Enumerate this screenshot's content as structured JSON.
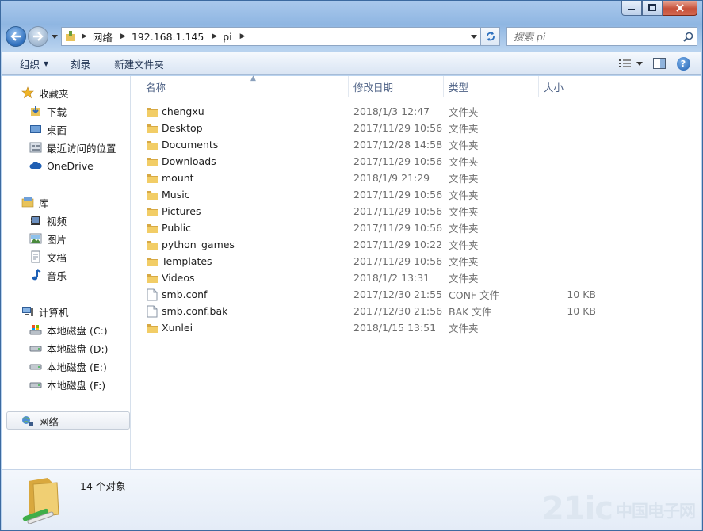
{
  "window": {
    "caption_buttons": [
      "minimize",
      "maximize",
      "close"
    ]
  },
  "address_bar": {
    "crumbs": [
      "网络",
      "192.168.1.145",
      "pi"
    ]
  },
  "search": {
    "placeholder": "搜索 pi"
  },
  "toolbar": {
    "organize_label": "组织",
    "burn_label": "刻录",
    "new_folder_label": "新建文件夹"
  },
  "nav_pane": {
    "favorites": {
      "label": "收藏夹",
      "items": [
        "下载",
        "桌面",
        "最近访问的位置",
        "OneDrive"
      ]
    },
    "libraries": {
      "label": "库",
      "items": [
        "视频",
        "图片",
        "文档",
        "音乐"
      ]
    },
    "computer": {
      "label": "计算机",
      "items": [
        "本地磁盘 (C:)",
        "本地磁盘 (D:)",
        "本地磁盘 (E:)",
        "本地磁盘 (F:)"
      ]
    },
    "network": {
      "label": "网络"
    }
  },
  "columns": {
    "name": "名称",
    "date": "修改日期",
    "type": "类型",
    "size": "大小"
  },
  "files": [
    {
      "name": "chengxu",
      "date": "2018/1/3 12:47",
      "type": "文件夹",
      "size": "",
      "icon": "folder-icon"
    },
    {
      "name": "Desktop",
      "date": "2017/11/29 10:56",
      "type": "文件夹",
      "size": "",
      "icon": "folder-icon"
    },
    {
      "name": "Documents",
      "date": "2017/12/28 14:58",
      "type": "文件夹",
      "size": "",
      "icon": "folder-icon"
    },
    {
      "name": "Downloads",
      "date": "2017/11/29 10:56",
      "type": "文件夹",
      "size": "",
      "icon": "folder-icon"
    },
    {
      "name": "mount",
      "date": "2018/1/9 21:29",
      "type": "文件夹",
      "size": "",
      "icon": "folder-icon"
    },
    {
      "name": "Music",
      "date": "2017/11/29 10:56",
      "type": "文件夹",
      "size": "",
      "icon": "folder-icon"
    },
    {
      "name": "Pictures",
      "date": "2017/11/29 10:56",
      "type": "文件夹",
      "size": "",
      "icon": "folder-icon"
    },
    {
      "name": "Public",
      "date": "2017/11/29 10:56",
      "type": "文件夹",
      "size": "",
      "icon": "folder-icon"
    },
    {
      "name": "python_games",
      "date": "2017/11/29 10:22",
      "type": "文件夹",
      "size": "",
      "icon": "folder-icon"
    },
    {
      "name": "Templates",
      "date": "2017/11/29 10:56",
      "type": "文件夹",
      "size": "",
      "icon": "folder-icon"
    },
    {
      "name": "Videos",
      "date": "2018/1/2 13:31",
      "type": "文件夹",
      "size": "",
      "icon": "folder-icon"
    },
    {
      "name": "smb.conf",
      "date": "2017/12/30 21:55",
      "type": "CONF 文件",
      "size": "10 KB",
      "icon": "file-icon"
    },
    {
      "name": "smb.conf.bak",
      "date": "2017/12/30 21:56",
      "type": "BAK 文件",
      "size": "10 KB",
      "icon": "file-icon"
    },
    {
      "name": "Xunlei",
      "date": "2018/1/15 13:51",
      "type": "文件夹",
      "size": "",
      "icon": "folder-icon"
    }
  ],
  "details": {
    "count_text": "14 个对象"
  },
  "watermark": {
    "text": "21ic",
    "cn_text": "中国电子网"
  },
  "colors": {
    "folder": "#e8c35a",
    "accent": "#3c6aa0",
    "header_text": "#4d6185"
  }
}
